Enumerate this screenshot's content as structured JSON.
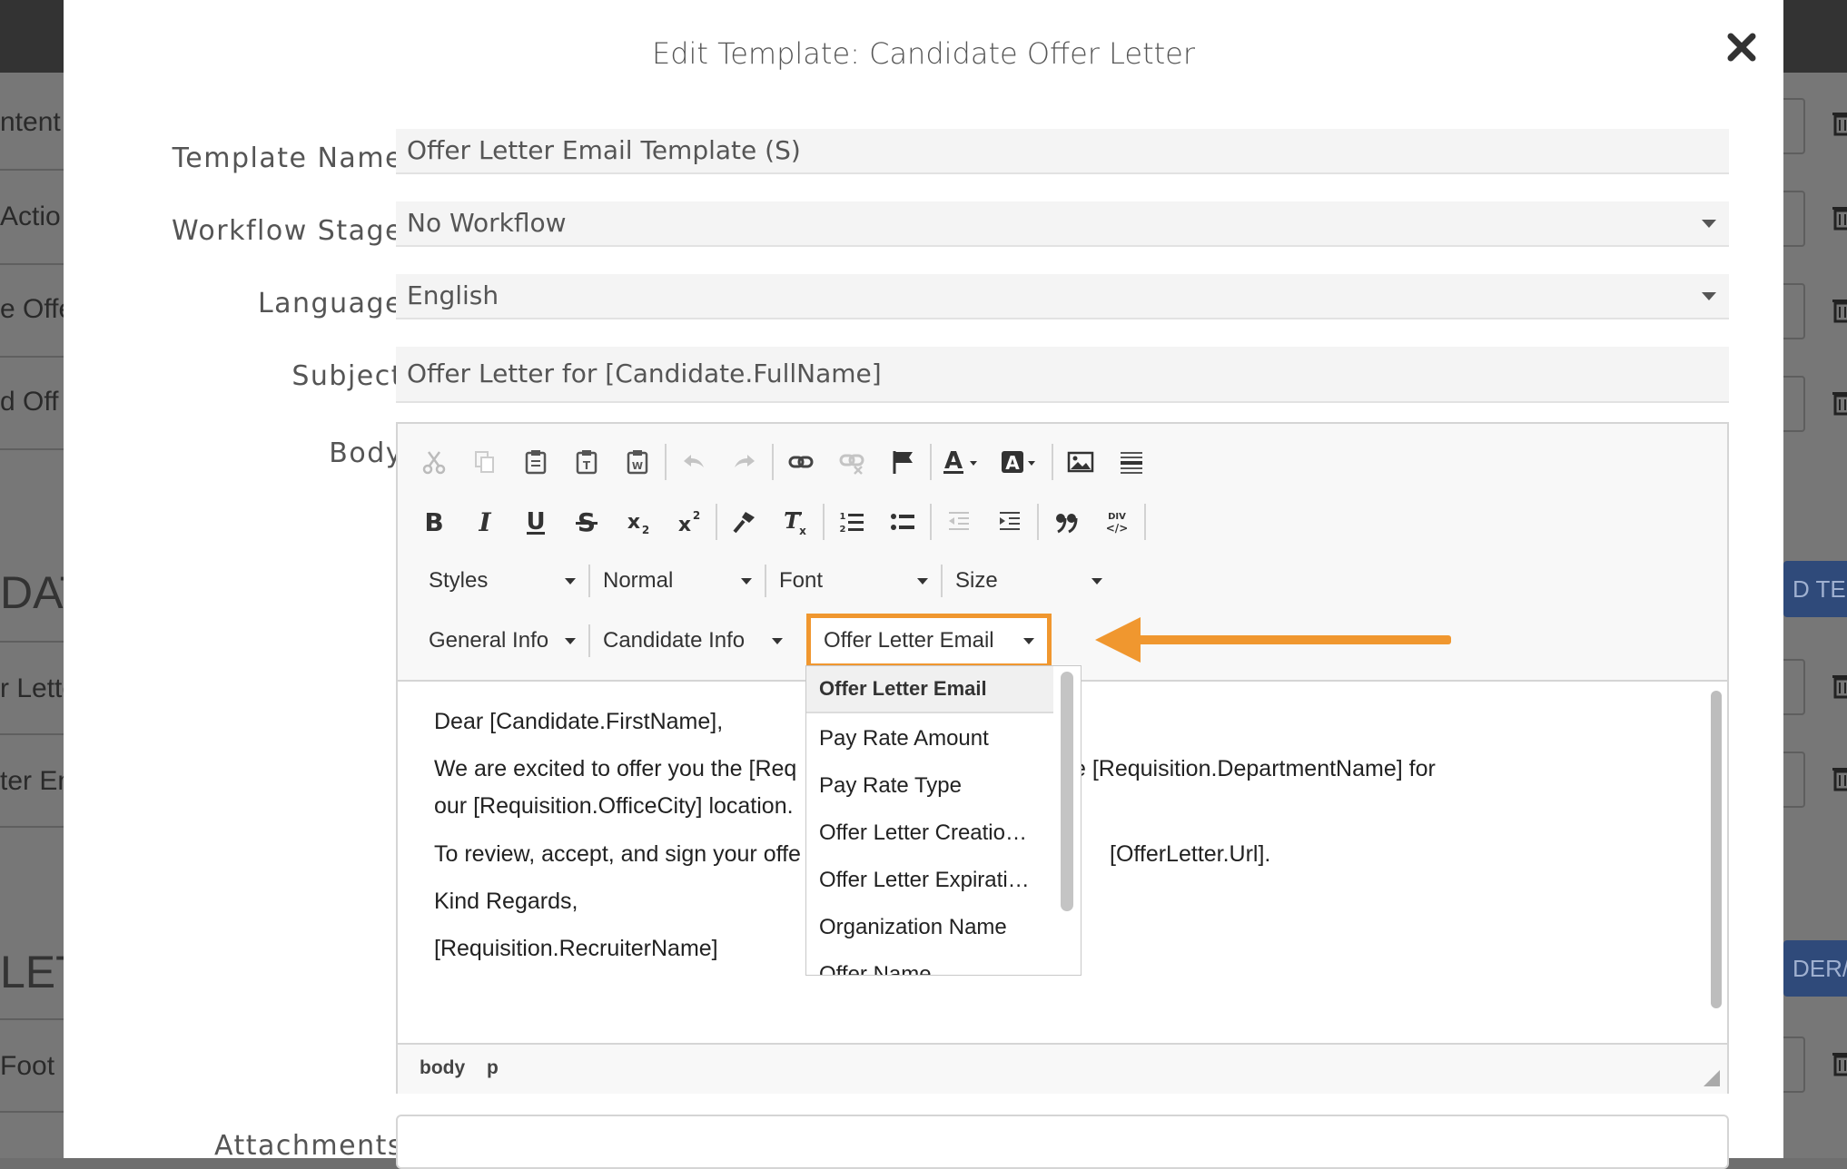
{
  "background": {
    "left_snippets": [
      "ntent",
      "Actio",
      "e Offe",
      "d Off",
      "DAT",
      "r Lette",
      "ter Em",
      "LET",
      "Foot"
    ],
    "right_buttons": [
      "D TE",
      "DER/"
    ]
  },
  "modal": {
    "title": "Edit Template: Candidate Offer Letter",
    "close_label": "✖"
  },
  "form": {
    "template_name": {
      "label": "Template Name",
      "value": "Offer Letter Email Template (S)"
    },
    "workflow_stage": {
      "label": "Workflow Stage",
      "value": "No Workflow"
    },
    "language": {
      "label": "Language",
      "value": "English"
    },
    "subject": {
      "label": "Subject",
      "value": "Offer Letter for [Candidate.FullName]"
    },
    "body_label": "Body",
    "attachments_label": "Attachments"
  },
  "toolbar": {
    "row3": [
      {
        "label": "Styles",
        "name": "styles-combo"
      },
      {
        "label": "Normal",
        "name": "format-combo"
      },
      {
        "label": "Font",
        "name": "font-combo"
      },
      {
        "label": "Size",
        "name": "size-combo"
      }
    ],
    "row4": [
      {
        "label": "General Info",
        "name": "general-info-combo"
      },
      {
        "label": "Candidate Info",
        "name": "candidate-info-combo"
      },
      {
        "label": "Offer Letter Email",
        "name": "offer-letter-email-combo"
      }
    ]
  },
  "body_content": {
    "lines": [
      "Dear [Candidate.FirstName],",
      "We are excited to offer you the [Req",
      "our [Requisition.OfficeCity] location.",
      "To review, accept, and sign your offe",
      "Kind Regards,",
      "[Requisition.RecruiterName]"
    ],
    "line2_tail": "e [Requisition.DepartmentName] for",
    "line4_tail": "[OfferLetter.Url]."
  },
  "status_path": [
    "body",
    "p"
  ],
  "dropdown": {
    "header": "Offer Letter Email",
    "items": [
      "Pay Rate Amount",
      "Pay Rate Type",
      "Offer Letter Creatio…",
      "Offer Letter Expirati…",
      "Organization Name",
      "Offer Name"
    ]
  },
  "colors": {
    "highlight": "#f0972f",
    "overlay": "#777777",
    "modal_bg": "#ffffff"
  }
}
